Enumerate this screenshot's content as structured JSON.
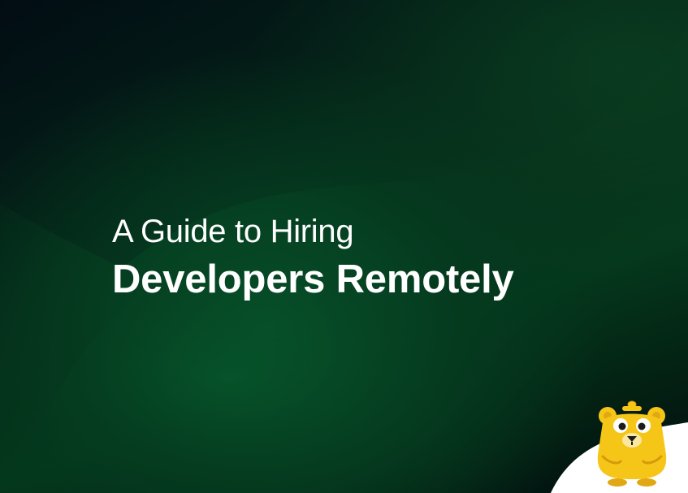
{
  "headline": {
    "line1": "A Guide to Hiring",
    "line2": "Developers Remotely"
  },
  "mascot": {
    "icon": "bear-mascot-icon"
  },
  "colors": {
    "background_dark": "#020c14",
    "background_green": "#06522a",
    "text": "#ffffff",
    "mascot_yellow": "#f5c518",
    "corner_white": "#ffffff"
  }
}
